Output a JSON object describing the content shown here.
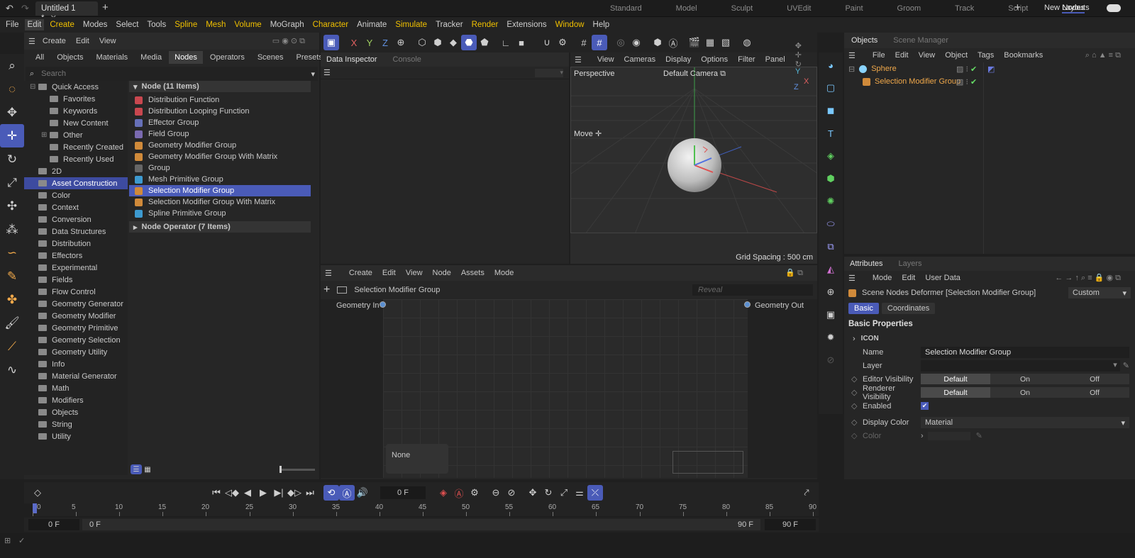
{
  "window": {
    "doc_tab": "Untitled 1 *",
    "plus": "+",
    "layouts": [
      "Standard",
      "Model",
      "Sculpt",
      "UVEdit",
      "Paint",
      "Groom",
      "Track",
      "Script",
      "Nodes"
    ],
    "active_layout": "Nodes",
    "new_layouts": "New Layouts"
  },
  "menu": [
    "File",
    "Edit",
    "Create",
    "Modes",
    "Select",
    "Tools",
    "Spline",
    "Mesh",
    "Volume",
    "MoGraph",
    "Character",
    "Animate",
    "Simulate",
    "Tracker",
    "Render",
    "Extensions",
    "Window",
    "Help"
  ],
  "asset_browser": {
    "menu": [
      "Create",
      "Edit",
      "View"
    ],
    "tabs": [
      "All",
      "Objects",
      "Materials",
      "Media",
      "Nodes",
      "Operators",
      "Scenes",
      "Presets"
    ],
    "active_tab": "Nodes",
    "search_placeholder": "Search",
    "tree": [
      {
        "label": "Quick Access",
        "level": 0,
        "exp": "⊟"
      },
      {
        "label": "Favorites",
        "level": 1
      },
      {
        "label": "Keywords",
        "level": 1
      },
      {
        "label": "New Content",
        "level": 1
      },
      {
        "label": "Other",
        "level": 1,
        "exp": "⊞"
      },
      {
        "label": "Recently Created",
        "level": 1
      },
      {
        "label": "Recently Used",
        "level": 1
      },
      {
        "label": "2D",
        "level": 0
      },
      {
        "label": "Asset Construction",
        "level": 0,
        "sel": true
      },
      {
        "label": "Color",
        "level": 0
      },
      {
        "label": "Context",
        "level": 0
      },
      {
        "label": "Conversion",
        "level": 0
      },
      {
        "label": "Data Structures",
        "level": 0
      },
      {
        "label": "Distribution",
        "level": 0
      },
      {
        "label": "Effectors",
        "level": 0
      },
      {
        "label": "Experimental",
        "level": 0
      },
      {
        "label": "Fields",
        "level": 0
      },
      {
        "label": "Flow Control",
        "level": 0
      },
      {
        "label": "Geometry Generator",
        "level": 0
      },
      {
        "label": "Geometry Modifier",
        "level": 0
      },
      {
        "label": "Geometry Primitive",
        "level": 0
      },
      {
        "label": "Geometry Selection",
        "level": 0
      },
      {
        "label": "Geometry Utility",
        "level": 0
      },
      {
        "label": "Info",
        "level": 0
      },
      {
        "label": "Material Generator",
        "level": 0
      },
      {
        "label": "Math",
        "level": 0
      },
      {
        "label": "Modifiers",
        "level": 0
      },
      {
        "label": "Objects",
        "level": 0
      },
      {
        "label": "String",
        "level": 0
      },
      {
        "label": "Utility",
        "level": 0
      }
    ],
    "group1": "Node (11 Items)",
    "group2": "Node Operator (7 Items)",
    "nodes": [
      {
        "label": "Distribution Function",
        "color": "#c8474f"
      },
      {
        "label": "Distribution Looping Function",
        "color": "#c8474f"
      },
      {
        "label": "Effector Group",
        "color": "#6670b8"
      },
      {
        "label": "Field Group",
        "color": "#7a6ab0"
      },
      {
        "label": "Geometry Modifier Group",
        "color": "#d08a3a"
      },
      {
        "label": "Geometry Modifier Group With Matrix",
        "color": "#d08a3a"
      },
      {
        "label": "Group",
        "color": "#666"
      },
      {
        "label": "Mesh Primitive Group",
        "color": "#3d9ad0"
      },
      {
        "label": "Selection Modifier Group",
        "color": "#d08a3a",
        "sel": true
      },
      {
        "label": "Selection Modifier Group With Matrix",
        "color": "#d08a3a"
      },
      {
        "label": "Spline Primitive Group",
        "color": "#3d9ad0"
      }
    ]
  },
  "data_inspector": {
    "tabs": [
      "Data Inspector",
      "Console"
    ]
  },
  "viewport": {
    "menu": [
      "View",
      "Cameras",
      "Display",
      "Options",
      "Filter",
      "Panel"
    ],
    "perspective": "Perspective",
    "camera": "Default Camera",
    "move": "Move",
    "grid_spacing": "Grid Spacing : 500 cm",
    "axis_x": "X",
    "axis_y": "Y",
    "axis_z": "Z"
  },
  "node_editor": {
    "menu": [
      "Create",
      "Edit",
      "View",
      "Node",
      "Assets",
      "Mode"
    ],
    "breadcrumb": "Selection Modifier Group",
    "reveal": "Reveal",
    "geometry_in": "Geometry In",
    "geometry_out": "Geometry Out",
    "none": "None"
  },
  "objects": {
    "tabs": [
      "Objects",
      "Scene Manager"
    ],
    "menu": [
      "File",
      "Edit",
      "View",
      "Object",
      "Tags",
      "Bookmarks"
    ],
    "items": [
      "Sphere",
      "Selection Modifier Group"
    ]
  },
  "attributes": {
    "tabs": [
      "Attributes",
      "Layers"
    ],
    "menu": [
      "Mode",
      "Edit",
      "User Data"
    ],
    "title": "Scene Nodes Deformer [Selection Modifier Group]",
    "preset": "Custom",
    "subtabs": [
      "Basic",
      "Coordinates"
    ],
    "section": "Basic Properties",
    "icon_label": "ICON",
    "name_label": "Name",
    "name_value": "Selection Modifier Group",
    "layer_label": "Layer",
    "editor_vis": "Editor Visibility",
    "render_vis": "Renderer Visibility",
    "seg": [
      "Default",
      "On",
      "Off"
    ],
    "enabled": "Enabled",
    "display_color": "Display Color",
    "display_color_value": "Material",
    "color": "Color"
  },
  "timeline": {
    "frame": "0 F",
    "ticks": [
      "0",
      "5",
      "10",
      "15",
      "20",
      "25",
      "30",
      "35",
      "40",
      "45",
      "50",
      "55",
      "60",
      "65",
      "70",
      "75",
      "80",
      "85",
      "90"
    ],
    "start": "0 F",
    "range_start": "0 F",
    "range_end": "90 F",
    "end": "90 F"
  }
}
